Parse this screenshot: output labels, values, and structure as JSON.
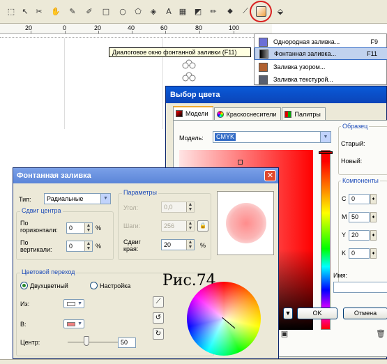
{
  "ruler": {
    "labels": [
      "20",
      "0",
      "20",
      "40",
      "60",
      "80",
      "100"
    ]
  },
  "tooltip": {
    "text": "Диалоговое окно фонтанной заливки (F11)"
  },
  "menu": {
    "items": [
      {
        "label": "Однородная заливка...",
        "key": "F9",
        "color": "#6b6fd6"
      },
      {
        "label": "Фонтанная заливка...",
        "key": "F11",
        "color": "#202020"
      },
      {
        "label": "Заливка узором...",
        "key": "",
        "color": "#b06030"
      },
      {
        "label": "Заливка текстурой...",
        "key": "",
        "color": "#5a6070"
      }
    ]
  },
  "color_dialog": {
    "title": "Выбор цвета",
    "tabs": [
      "Модели",
      "Краскоснесители",
      "Палитры"
    ],
    "model_label": "Модель:",
    "model_value": "CMYK",
    "sample_title": "Образец",
    "old_label": "Старый:",
    "new_label": "Новый:",
    "components_title": "Компоненты",
    "components": [
      {
        "letter": "C",
        "value": "0"
      },
      {
        "letter": "M",
        "value": "50"
      },
      {
        "letter": "Y",
        "value": "20"
      },
      {
        "letter": "K",
        "value": "0"
      }
    ],
    "name_label": "Имя:",
    "ok": "OK",
    "cancel": "Отмена"
  },
  "fountain": {
    "title": "Фонтанная заливка",
    "close": "✕",
    "type_label": "Тип:",
    "type_value": "Радиальные",
    "params_title": "Параметры",
    "angle_label": "Угол:",
    "angle_value": "0,0",
    "steps_label": "Шаги:",
    "steps_value": "256",
    "edge_label": "Сдвиг края:",
    "edge_value": "20",
    "edge_unit": "%",
    "center_shift_title": "Сдвиг центра",
    "horiz_label": "По горизонтали:",
    "horiz_value": "0",
    "vert_label": "По вертикали:",
    "vert_value": "0",
    "pct": "%",
    "transition_title": "Цветовой переход",
    "two_color": "Двухцветный",
    "custom": "Настройка",
    "from_label": "Из:",
    "to_label": "В:",
    "center_label": "Центр:",
    "center_value": "50",
    "to_color": "#f08080"
  },
  "figure_label": "Рис.74"
}
